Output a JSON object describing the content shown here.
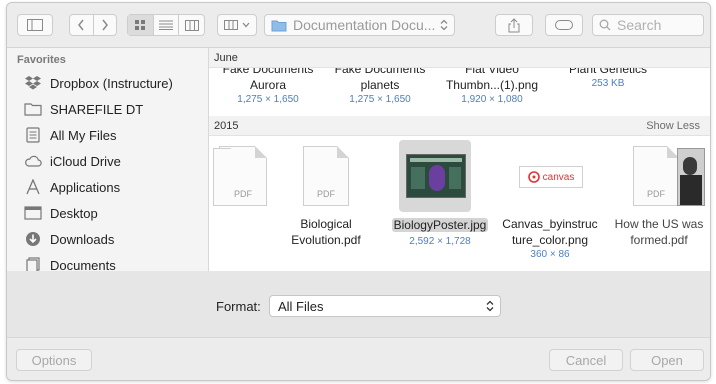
{
  "toolbar": {
    "location": "Documentation Docu...",
    "search_placeholder": "Search"
  },
  "sidebar": {
    "heading": "Favorites",
    "items": [
      {
        "label": "Dropbox (Instructure)",
        "icon": "dropbox-icon"
      },
      {
        "label": "SHAREFILE DT",
        "icon": "folder-icon"
      },
      {
        "label": "All My Files",
        "icon": "all-files-icon"
      },
      {
        "label": "iCloud Drive",
        "icon": "cloud-icon"
      },
      {
        "label": "Applications",
        "icon": "applications-icon"
      },
      {
        "label": "Desktop",
        "icon": "desktop-icon"
      },
      {
        "label": "Downloads",
        "icon": "downloads-icon"
      },
      {
        "label": "Documents",
        "icon": "documents-icon"
      }
    ]
  },
  "groups": {
    "june": {
      "label": "June",
      "files": [
        {
          "name": "Fake Documents",
          "line2": "Aurora",
          "dims": "1,275 × 1,650"
        },
        {
          "name": "Fake Documents",
          "line2": "planets",
          "dims": "1,275 × 1,650"
        },
        {
          "name": "Flat Video",
          "line2": "Thumbn...(1).png",
          "dims": "1,920 × 1,080"
        },
        {
          "name": "Plant Genetics",
          "line2": "",
          "dims": "253 KB"
        }
      ]
    },
    "y2015": {
      "label": "2015",
      "show_less": "Show Less",
      "files": [
        {
          "line1": "",
          "line2": "",
          "dims": "",
          "kind": "pdf"
        },
        {
          "line1": "Biological",
          "line2": "Evolution.pdf",
          "dims": "",
          "kind": "pdf"
        },
        {
          "line1": "BiologyPoster.jpg",
          "line2": "",
          "dims": "2,592 × 1,728",
          "kind": "poster"
        },
        {
          "line1": "Canvas_byinstruc",
          "line2": "ture_color.png",
          "dims": "360 × 86",
          "kind": "canvas",
          "logo_text": "canvas"
        },
        {
          "line1": "How the US was",
          "line2": "formed.pdf",
          "dims": "",
          "kind": "pdf-portrait"
        }
      ]
    }
  },
  "pdf_badge": "PDF",
  "format": {
    "label": "Format:",
    "value": "All Files"
  },
  "buttons": {
    "options": "Options",
    "cancel": "Cancel",
    "open": "Open"
  },
  "colors": {
    "selection": "#d4d4d4",
    "accent_blue": "#4a7fc1",
    "canvas_red": "#e3342f"
  }
}
